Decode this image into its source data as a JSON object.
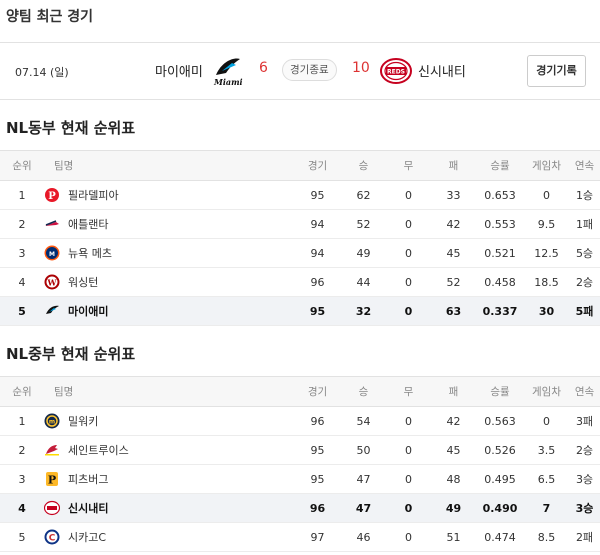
{
  "headings": {
    "recent": "양팀 최근 경기",
    "east": "NL동부 현재 순위표",
    "central": "NL중부 현재 순위표"
  },
  "game": {
    "date": "07.14 (일)",
    "away_team": "마이애미",
    "away_score": "6",
    "status": "경기종료",
    "home_score": "10",
    "home_team": "신시내티",
    "record_button": "경기기록"
  },
  "columns": [
    "순위",
    "팀명",
    "경기",
    "승",
    "무",
    "패",
    "승률",
    "게임차",
    "연속"
  ],
  "east": [
    {
      "rank": "1",
      "team": "필라델피아",
      "logo": "phillies-logo",
      "g": "95",
      "w": "62",
      "d": "0",
      "l": "33",
      "pct": "0.653",
      "gb": "0",
      "streak": "1승",
      "highlight": false
    },
    {
      "rank": "2",
      "team": "애틀랜타",
      "logo": "braves-logo",
      "g": "94",
      "w": "52",
      "d": "0",
      "l": "42",
      "pct": "0.553",
      "gb": "9.5",
      "streak": "1패",
      "highlight": false
    },
    {
      "rank": "3",
      "team": "뉴욕 메츠",
      "logo": "mets-logo",
      "g": "94",
      "w": "49",
      "d": "0",
      "l": "45",
      "pct": "0.521",
      "gb": "12.5",
      "streak": "5승",
      "highlight": false
    },
    {
      "rank": "4",
      "team": "워싱턴",
      "logo": "nationals-logo",
      "g": "96",
      "w": "44",
      "d": "0",
      "l": "52",
      "pct": "0.458",
      "gb": "18.5",
      "streak": "2승",
      "highlight": false
    },
    {
      "rank": "5",
      "team": "마이애미",
      "logo": "marlins-logo",
      "g": "95",
      "w": "32",
      "d": "0",
      "l": "63",
      "pct": "0.337",
      "gb": "30",
      "streak": "5패",
      "highlight": true
    }
  ],
  "central": [
    {
      "rank": "1",
      "team": "밀워키",
      "logo": "brewers-logo",
      "g": "96",
      "w": "54",
      "d": "0",
      "l": "42",
      "pct": "0.563",
      "gb": "0",
      "streak": "3패",
      "highlight": false
    },
    {
      "rank": "2",
      "team": "세인트루이스",
      "logo": "cardinals-logo",
      "g": "95",
      "w": "50",
      "d": "0",
      "l": "45",
      "pct": "0.526",
      "gb": "3.5",
      "streak": "2승",
      "highlight": false
    },
    {
      "rank": "3",
      "team": "피츠버그",
      "logo": "pirates-logo",
      "g": "95",
      "w": "47",
      "d": "0",
      "l": "48",
      "pct": "0.495",
      "gb": "6.5",
      "streak": "3승",
      "highlight": false
    },
    {
      "rank": "4",
      "team": "신시내티",
      "logo": "reds-logo",
      "g": "96",
      "w": "47",
      "d": "0",
      "l": "49",
      "pct": "0.490",
      "gb": "7",
      "streak": "3승",
      "highlight": true
    },
    {
      "rank": "5",
      "team": "시카고C",
      "logo": "cubs-logo",
      "g": "97",
      "w": "46",
      "d": "0",
      "l": "51",
      "pct": "0.474",
      "gb": "8.5",
      "streak": "2패",
      "highlight": false
    }
  ],
  "colors": {
    "score": "#dd3333",
    "accent_red": "#c6011f",
    "marlins_teal": "#00a3e0"
  }
}
